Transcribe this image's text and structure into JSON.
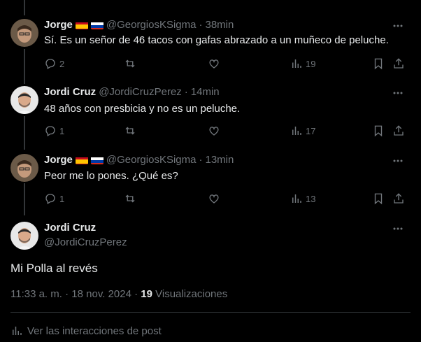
{
  "replies": [
    {
      "name": "Jorge",
      "flags": [
        "Spain",
        "Russia"
      ],
      "handle": "@GeorgiosKSigma",
      "sep": "·",
      "time": "38min",
      "text": "Sí. Es un señor de 46 tacos con gafas abrazado a un muñeco de peluche.",
      "replies_count": "2",
      "retweets_count": "",
      "likes_count": "",
      "views_count": "19"
    },
    {
      "name": "Jordi Cruz",
      "flags": [],
      "handle": "@JordiCruzPerez",
      "sep": "·",
      "time": "14min",
      "text": "48 años con presbicia y no es un peluche.",
      "replies_count": "1",
      "retweets_count": "",
      "likes_count": "",
      "views_count": "17"
    },
    {
      "name": "Jorge",
      "flags": [
        "Spain",
        "Russia"
      ],
      "handle": "@GeorgiosKSigma",
      "sep": "·",
      "time": "13min",
      "text": "Peor me lo pones. ¿Qué es?",
      "replies_count": "1",
      "retweets_count": "",
      "likes_count": "",
      "views_count": "13"
    }
  ],
  "main": {
    "name": "Jordi Cruz",
    "handle": "@JordiCruzPerez",
    "text": "Mi Polla al revés",
    "time": "11:33 a. m.",
    "sep": "·",
    "date": "18 nov. 2024",
    "sep2": "·",
    "views": "19",
    "views_label": "Visualizaciones"
  },
  "insights_label": "Ver las interacciones de post",
  "colors": {
    "background": "#000000",
    "text": "#e7e9ea",
    "muted": "#71767b",
    "divider": "#2f3336"
  }
}
